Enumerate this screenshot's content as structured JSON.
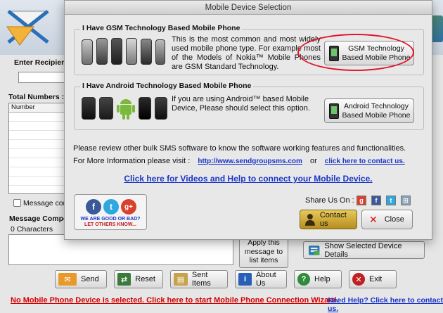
{
  "background": {
    "enter_recipient_label": "Enter Recipient",
    "total_numbers_label": "Total Numbers :",
    "number_column_header": "Number",
    "message_checkbox_label": "Message con",
    "message_compose_label": "Message Compos",
    "characters_count": "0 Characters",
    "apply_button": [
      "Apply this",
      "message to",
      "list items"
    ],
    "show_device_details_button": "Show Selected Device Details",
    "side_link_fragment": "ls",
    "side_text_fragment": "s"
  },
  "toolbar": {
    "buttons": [
      {
        "label": "Send",
        "icon": "envelope-icon",
        "color": "#e79a2a"
      },
      {
        "label": "Reset",
        "icon": "reset-arrows-icon",
        "color": "#3b7a3b"
      },
      {
        "label": "Sent Items",
        "icon": "folder-icon",
        "color": "#c7a24a"
      },
      {
        "label": "About Us",
        "icon": "info-icon",
        "color": "#2a5fb8"
      },
      {
        "label": "Help",
        "icon": "help-icon",
        "color": "#2f8a3a"
      },
      {
        "label": "Exit",
        "icon": "exit-icon",
        "color": "#c02020"
      }
    ]
  },
  "status": {
    "left": "No Mobile Phone Device is selected. Click here to start Mobile Phone Connection Wizard.",
    "right": "Need Help? Click here to contact us."
  },
  "dialog": {
    "title": "Mobile Device Selection",
    "gsm": {
      "legend": "I Have GSM Technology Based Mobile Phone",
      "description": "This is the most common and most widely used mobile phone type. For example most of the Models of Nokia™ Mobile Phones are GSM Standard Technology.",
      "button": [
        "GSM Technology",
        "Based Mobile Phone"
      ]
    },
    "android": {
      "legend": "I Have Android Technology Based Mobile Phone",
      "description": "If you are using Android™ based Mobile Device, Please should select this option.",
      "button": [
        "Android Technology",
        "Based Mobile Phone"
      ]
    },
    "review_text": "Please review other bulk SMS software to know the software working features and functionalities.",
    "more_info_label": "For More Information please visit :",
    "website_link": "http://www.sendgroupsms.com",
    "or_text": "or",
    "contact_link": "click here to contact us.",
    "video_help_link": "Click here for Videos and Help to connect your Mobile Device.",
    "social": {
      "good_bad_line1": "WE ARE GOOD OR BAD?",
      "good_bad_line2": "LET OTHERS KNOW..."
    },
    "share_label": "Share Us On :",
    "contact_button": "Contact us",
    "close_button": "Close"
  },
  "colors": {
    "accent_red": "#e0162b",
    "link_blue": "#1a35c8",
    "status_red": "#d10000"
  }
}
